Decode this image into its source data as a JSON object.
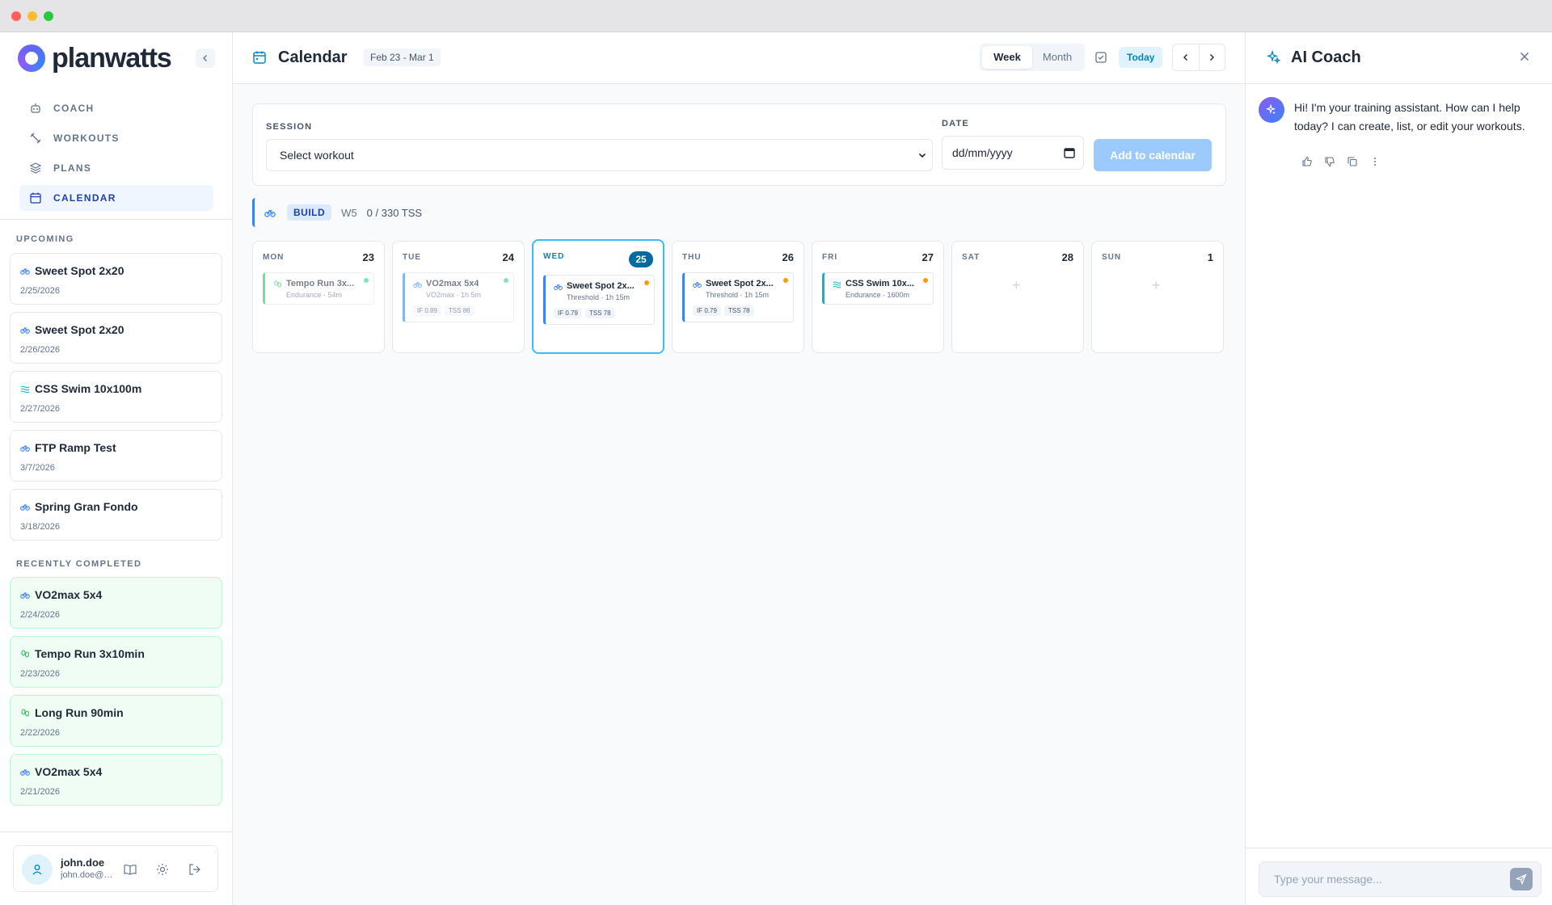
{
  "app": {
    "name": "planwatts"
  },
  "nav": [
    {
      "label": "COACH",
      "icon": "robot-icon",
      "active": false
    },
    {
      "label": "WORKOUTS",
      "icon": "dumbbell-icon",
      "active": false
    },
    {
      "label": "PLANS",
      "icon": "layers-icon",
      "active": false
    },
    {
      "label": "CALENDAR",
      "icon": "calendar-icon",
      "active": true
    }
  ],
  "upcoming": {
    "label": "UPCOMING",
    "items": [
      {
        "title": "Sweet Spot 2x20",
        "date": "2/25/2026",
        "sport": "bike"
      },
      {
        "title": "Sweet Spot 2x20",
        "date": "2/26/2026",
        "sport": "bike"
      },
      {
        "title": "CSS Swim 10x100m",
        "date": "2/27/2026",
        "sport": "swim"
      },
      {
        "title": "FTP Ramp Test",
        "date": "3/7/2026",
        "sport": "bike"
      },
      {
        "title": "Spring Gran Fondo",
        "date": "3/18/2026",
        "sport": "bike"
      }
    ]
  },
  "completed": {
    "label": "RECENTLY COMPLETED",
    "items": [
      {
        "title": "VO2max 5x4",
        "date": "2/24/2026",
        "sport": "bike"
      },
      {
        "title": "Tempo Run 3x10min",
        "date": "2/23/2026",
        "sport": "run"
      },
      {
        "title": "Long Run 90min",
        "date": "2/22/2026",
        "sport": "run"
      },
      {
        "title": "VO2max 5x4",
        "date": "2/21/2026",
        "sport": "bike"
      }
    ]
  },
  "user": {
    "name": "john.doe",
    "email": "john.doe@p..."
  },
  "calendar": {
    "title": "Calendar",
    "range": "Feb 23 - Mar 1",
    "views": [
      "Week",
      "Month"
    ],
    "active_view": "Week",
    "today_label": "Today"
  },
  "add_session": {
    "session_label": "SESSION",
    "session_value": "Select workout",
    "date_label": "DATE",
    "date_placeholder": "dd/mm/yyyy",
    "button": "Add to calendar"
  },
  "phase": {
    "name": "BUILD",
    "week": "W5",
    "tss": "0 / 330 TSS"
  },
  "days": [
    {
      "name": "MON",
      "num": "23",
      "today": false,
      "session": {
        "title": "Tempo Run 3x...",
        "sub": "Endurance · 54m",
        "sport": "run",
        "muted": true,
        "status": "#34d399",
        "metrics": []
      }
    },
    {
      "name": "TUE",
      "num": "24",
      "today": false,
      "session": {
        "title": "VO2max 5x4",
        "sub": "VO2max · 1h 5m",
        "sport": "bike",
        "muted": true,
        "status": "#34d399",
        "metrics": [
          "IF 0.89",
          "TSS 86"
        ]
      }
    },
    {
      "name": "WED",
      "num": "25",
      "today": true,
      "session": {
        "title": "Sweet Spot 2x...",
        "sub": "Threshold · 1h 15m",
        "sport": "bike",
        "muted": false,
        "status": "#f59e0b",
        "metrics": [
          "IF 0.79",
          "TSS 78"
        ]
      }
    },
    {
      "name": "THU",
      "num": "26",
      "today": false,
      "session": {
        "title": "Sweet Spot 2x...",
        "sub": "Threshold · 1h 15m",
        "sport": "bike",
        "muted": false,
        "status": "#f59e0b",
        "metrics": [
          "IF 0.79",
          "TSS 78"
        ]
      }
    },
    {
      "name": "FRI",
      "num": "27",
      "today": false,
      "session": {
        "title": "CSS Swim 10x...",
        "sub": "Endurance · 1600m",
        "sport": "swim",
        "muted": false,
        "status": "#f59e0b",
        "metrics": []
      }
    },
    {
      "name": "SAT",
      "num": "28",
      "today": false,
      "session": null
    },
    {
      "name": "SUN",
      "num": "1",
      "today": false,
      "session": null
    }
  ],
  "coach": {
    "title": "AI Coach",
    "message": "Hi! I'm your training assistant. How can I help today? I can create, list, or edit your workouts.",
    "input_placeholder": "Type your message..."
  },
  "colors": {
    "bike": "#3b82f6",
    "run": "#22c55e",
    "swim": "#06b6d4",
    "accent": "#0284c7"
  }
}
